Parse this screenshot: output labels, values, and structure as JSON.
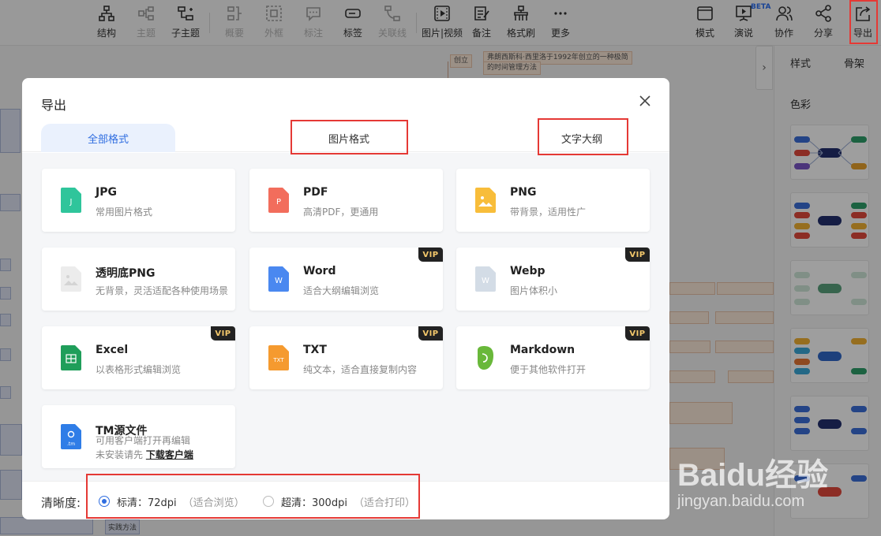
{
  "toolbar": {
    "items": [
      {
        "label": "结构",
        "icon": "structure-icon",
        "disabled": false
      },
      {
        "label": "主题",
        "icon": "topic-icon",
        "disabled": true
      },
      {
        "label": "子主题",
        "icon": "subtopic-icon",
        "disabled": false
      },
      {
        "label": "概要",
        "icon": "summary-icon",
        "disabled": true
      },
      {
        "label": "外框",
        "icon": "frame-icon",
        "disabled": true
      },
      {
        "label": "标注",
        "icon": "callout-icon",
        "disabled": true
      },
      {
        "label": "标签",
        "icon": "tag-icon",
        "disabled": false
      },
      {
        "label": "关联线",
        "icon": "relation-line-icon",
        "disabled": true
      },
      {
        "label": "图片|视频",
        "icon": "image-video-icon",
        "disabled": false
      },
      {
        "label": "备注",
        "icon": "note-icon",
        "disabled": false
      },
      {
        "label": "格式刷",
        "icon": "format-brush-icon",
        "disabled": false
      },
      {
        "label": "更多",
        "icon": "more-icon",
        "disabled": false
      }
    ],
    "right_items": [
      {
        "label": "模式",
        "icon": "mode-icon"
      },
      {
        "label": "演说",
        "icon": "present-icon"
      },
      {
        "label": "协作",
        "icon": "collaborate-icon"
      },
      {
        "label": "分享",
        "icon": "share-icon"
      },
      {
        "label": "导出",
        "icon": "export-icon"
      }
    ],
    "beta_badge": "BETA"
  },
  "side_panel": {
    "tabs": [
      "样式",
      "骨架"
    ],
    "section_title": "色彩",
    "collapse_glyph": "›"
  },
  "canvas": {
    "notes": [
      "创立",
      "弗朗西斯科·西里洛于1992年创立的一种极简",
      "的时间管理方法"
    ],
    "bottom_node": "实践方法"
  },
  "dialog": {
    "title": "导出",
    "tabs": [
      {
        "label": "全部格式",
        "active": true
      },
      {
        "label": "图片格式",
        "active": false
      },
      {
        "label": "文字大纲",
        "active": false
      }
    ],
    "formats": [
      {
        "name": "JPG",
        "desc": "常用图片格式",
        "icon": "jpg-file-icon",
        "vip": false,
        "color": "#2fc59b",
        "glyph": "J"
      },
      {
        "name": "PDF",
        "desc": "高清PDF，更通用",
        "icon": "pdf-file-icon",
        "vip": false,
        "color": "#f26d5c",
        "glyph": "P"
      },
      {
        "name": "PNG",
        "desc": "带背景，适用性广",
        "icon": "png-file-icon",
        "vip": false,
        "color": "#f8bd3a",
        "glyph": "▲"
      },
      {
        "name": "透明底PNG",
        "desc": "无背景，灵活适配各种使用场景",
        "icon": "transparent-png-file-icon",
        "vip": false,
        "color": "#e4e4e4",
        "glyph": "▲"
      },
      {
        "name": "Word",
        "desc": "适合大纲编辑浏览",
        "icon": "word-file-icon",
        "vip": true,
        "color": "#4a88f0",
        "glyph": "W"
      },
      {
        "name": "Webp",
        "desc": "图片体积小",
        "icon": "webp-file-icon",
        "vip": true,
        "color": "#d3dce6",
        "glyph": "W"
      },
      {
        "name": "Excel",
        "desc": "以表格形式编辑浏览",
        "icon": "excel-file-icon",
        "vip": true,
        "color": "#1f9e5a",
        "glyph": "X"
      },
      {
        "name": "TXT",
        "desc": "纯文本，适合直接复制内容",
        "icon": "txt-file-icon",
        "vip": true,
        "color": "#f59a2f",
        "glyph": "TXT"
      },
      {
        "name": "Markdown",
        "desc": "便于其他软件打开",
        "icon": "markdown-file-icon",
        "vip": true,
        "color": "#69b83a",
        "glyph": "M"
      },
      {
        "name": "TM源文件",
        "desc": "可用客户端打开再编辑",
        "desc2": "未安装请先",
        "link": "下载客户端",
        "icon": "tm-file-icon",
        "vip": false,
        "color": "#2f7de7",
        "glyph": ".tm"
      }
    ],
    "vip_label": "VIP",
    "clarity": {
      "label": "清晰度:",
      "options": [
        {
          "label": "标清：72dpi",
          "hint": "（适合浏览）",
          "selected": true
        },
        {
          "label": "超清：300dpi",
          "hint": "（适合打印）",
          "selected": false
        }
      ]
    }
  },
  "watermark": {
    "logo": "Baidu经验",
    "url": "jingyan.baidu.com"
  }
}
